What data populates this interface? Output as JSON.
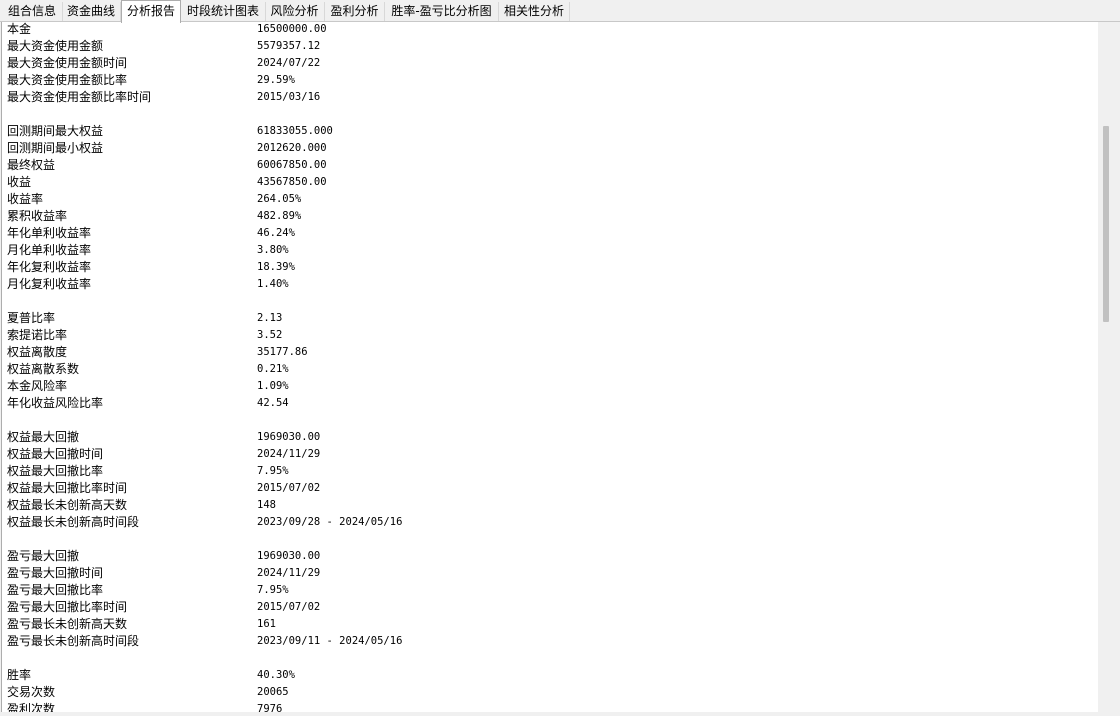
{
  "tabs": [
    {
      "label": "组合信息"
    },
    {
      "label": "资金曲线"
    },
    {
      "label": "分析报告"
    },
    {
      "label": "时段统计图表"
    },
    {
      "label": "风险分析"
    },
    {
      "label": "盈利分析"
    },
    {
      "label": "胜率-盈亏比分析图"
    },
    {
      "label": "相关性分析"
    }
  ],
  "active_tab": "分析报告",
  "report": {
    "groups": [
      [
        {
          "label": "本金",
          "value": "16500000.00"
        },
        {
          "label": "最大资金使用金额",
          "value": "5579357.12"
        },
        {
          "label": "最大资金使用金额时间",
          "value": "2024/07/22"
        },
        {
          "label": "最大资金使用金额比率",
          "value": "29.59%"
        },
        {
          "label": "最大资金使用金额比率时间",
          "value": "2015/03/16"
        }
      ],
      [
        {
          "label": "回测期间最大权益",
          "value": "61833055.000"
        },
        {
          "label": "回测期间最小权益",
          "value": "2012620.000"
        },
        {
          "label": "最终权益",
          "value": "60067850.00"
        },
        {
          "label": "收益",
          "value": "43567850.00"
        },
        {
          "label": "收益率",
          "value": "264.05%"
        },
        {
          "label": "累积收益率",
          "value": "482.89%"
        },
        {
          "label": "年化单利收益率",
          "value": "46.24%"
        },
        {
          "label": "月化单利收益率",
          "value": "3.80%"
        },
        {
          "label": "年化复利收益率",
          "value": "18.39%"
        },
        {
          "label": "月化复利收益率",
          "value": "1.40%"
        }
      ],
      [
        {
          "label": "夏普比率",
          "value": "2.13"
        },
        {
          "label": "索提诺比率",
          "value": "3.52"
        },
        {
          "label": "权益离散度",
          "value": "35177.86"
        },
        {
          "label": "权益离散系数",
          "value": "0.21%"
        },
        {
          "label": "本金风险率",
          "value": "1.09%"
        },
        {
          "label": "年化收益风险比率",
          "value": "42.54"
        }
      ],
      [
        {
          "label": "权益最大回撤",
          "value": "1969030.00"
        },
        {
          "label": "权益最大回撤时间",
          "value": "2024/11/29"
        },
        {
          "label": "权益最大回撤比率",
          "value": "7.95%"
        },
        {
          "label": "权益最大回撤比率时间",
          "value": "2015/07/02"
        },
        {
          "label": "权益最长未创新高天数",
          "value": "148"
        },
        {
          "label": "权益最长未创新高时间段",
          "value": "2023/09/28 - 2024/05/16"
        }
      ],
      [
        {
          "label": "盈亏最大回撤",
          "value": "1969030.00"
        },
        {
          "label": "盈亏最大回撤时间",
          "value": "2024/11/29"
        },
        {
          "label": "盈亏最大回撤比率",
          "value": "7.95%"
        },
        {
          "label": "盈亏最大回撤比率时间",
          "value": "2015/07/02"
        },
        {
          "label": "盈亏最长未创新高天数",
          "value": "161"
        },
        {
          "label": "盈亏最长未创新高时间段",
          "value": "2023/09/11 - 2024/05/16"
        }
      ],
      [
        {
          "label": "胜率",
          "value": "40.30%"
        },
        {
          "label": "交易次数",
          "value": "20065"
        },
        {
          "label": "盈利次数",
          "value": "7976"
        }
      ]
    ]
  }
}
